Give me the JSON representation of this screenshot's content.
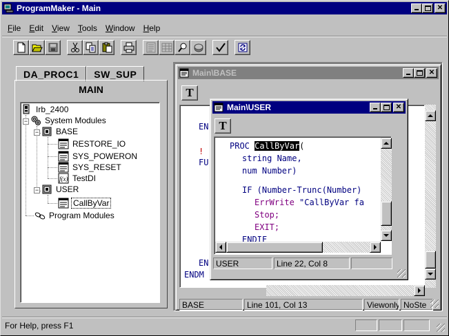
{
  "app": {
    "title": "ProgramMaker - Main"
  },
  "menu": [
    {
      "label": "File",
      "key": "F",
      "rest": "ile"
    },
    {
      "label": "Edit",
      "key": "E",
      "rest": "dit"
    },
    {
      "label": "View",
      "key": "V",
      "rest": "iew"
    },
    {
      "label": "Tools",
      "key": "T",
      "rest": "ools"
    },
    {
      "label": "Window",
      "key": "W",
      "rest": "indow"
    },
    {
      "label": "Help",
      "key": "H",
      "rest": "elp"
    }
  ],
  "toolbar": {
    "icons": [
      "new-file-icon",
      "open-folder-icon",
      "save-icon",
      "cut-icon",
      "copy-icon",
      "paste-icon",
      "print-icon",
      "text-view-icon",
      "table-view-icon",
      "find-icon",
      "disc-icon",
      "check-icon",
      "refresh-icon"
    ]
  },
  "left": {
    "tabs": [
      "DA_PROC1",
      "SW_SUP"
    ],
    "active_page": "MAIN",
    "tree": {
      "robot": "Irb_2400",
      "system_modules": "System Modules",
      "base": "BASE",
      "restore_io": "RESTORE_IO",
      "sys_poweron": "SYS_POWERON",
      "sys_reset": "SYS_RESET",
      "testdi": "TestDI",
      "user": "USER",
      "callbyvar": "CallByVar",
      "program_modules": "Program Modules"
    }
  },
  "base_window": {
    "title": "Main\\BASE",
    "t_label": "T",
    "code_fragments": {
      "en1": "EN",
      "excl": "!",
      "fu": "FU",
      "en2": "EN",
      "endm": "ENDM"
    },
    "status": {
      "module": "BASE",
      "position": "Line 101, Col  13",
      "mode": "Viewonly",
      "step": "NoSte"
    }
  },
  "user_window": {
    "title": "Main\\USER",
    "t_label": "T",
    "code": {
      "proc_kw": "PROC",
      "proc_name": "CallByVar",
      "proc_paren": "(",
      "line2": "string Name,",
      "line3": "num Number)",
      "if_kw": "IF",
      "if_rest": " (Number-Trunc(Number)",
      "errwrite_kw": "ErrWrite",
      "errwrite_rest": " \"CallByVar fa",
      "stop": "Stop;",
      "exit": "EXIT;",
      "endif": "ENDIF"
    },
    "status": {
      "module": "USER",
      "position": "Line  22, Col   8"
    }
  },
  "statusbar": {
    "help": "For Help, press F1"
  },
  "colors": {
    "title_active": "#000080",
    "title_inactive": "#808080",
    "face": "#c0c0c0",
    "mdi_bg": "#808080",
    "keyword": "#000080",
    "function": "#800080"
  }
}
